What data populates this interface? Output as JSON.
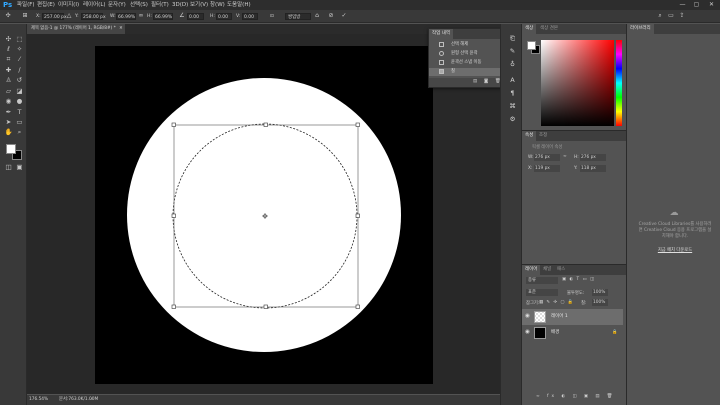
{
  "app": {
    "logo": "Ps"
  },
  "menu": [
    "파일(F)",
    "편집(E)",
    "이미지(I)",
    "레이어(L)",
    "문자(Y)",
    "선택(S)",
    "필터(T)",
    "3D(D)",
    "보기(V)",
    "창(W)",
    "도움말(H)"
  ],
  "window_controls": [
    "—",
    "▢",
    "✕"
  ],
  "options": {
    "x_label": "X:",
    "x_value": "257.00 px",
    "y_label": "Y:",
    "y_value": "258.00 px",
    "w_label": "W:",
    "w_value": "66.99%",
    "h_label": "H:",
    "h_value": "66.99%",
    "angle_value": "0.00",
    "h2_label": "H:",
    "h2_value": "0.00",
    "v_label": "V:",
    "v_value": "0.00",
    "interp_value": "쌍입방"
  },
  "document": {
    "tab_title": "제목 없음-1 @ 177% (레이어 1, RGB/8#) *",
    "tab_close": "✕",
    "background_color": "#000000",
    "circle_color": "#ffffff"
  },
  "status": {
    "zoom": "176.54%",
    "doc_info": "문서:763.0K/1.00M"
  },
  "history": {
    "tab": "작업 내역",
    "items": [
      "선택 해제",
      "원형 선택 윤곽",
      "윤곽선 스냅 이동",
      "칠"
    ],
    "selected_index": 3
  },
  "color_panel": {
    "tabs": [
      "색상",
      "색상 견본"
    ],
    "fg_color": "#ffffff",
    "bg_color": "#000000",
    "hue_color": "#ff0000"
  },
  "properties": {
    "tabs": [
      "속성",
      "조정"
    ],
    "section": "픽셀 레이어 속성",
    "w_label": "W:",
    "w_value": "276 px",
    "h_label": "H:",
    "h_value": "276 px",
    "x_label": "X:",
    "x_value": "119 px",
    "y_label": "Y:",
    "y_value": "118 px"
  },
  "libraries": {
    "tab": "라이브러리",
    "message": "Creative Cloud Libraries를 사용하려면 Creative Cloud 응용 프로그램을 설치해야 합니다.",
    "link": "지금 페치 다운로드"
  },
  "layers": {
    "tabs": [
      "레이어",
      "채널",
      "패스"
    ],
    "filter_label": "종류",
    "blend_mode": "표준",
    "opacity_label": "불투명도:",
    "opacity_value": "100%",
    "lock_label": "잠그기:",
    "fill_label": "칠:",
    "fill_value": "100%",
    "items": [
      {
        "name": "레이어 1",
        "selected": true,
        "thumb": "#ffffff"
      },
      {
        "name": "배경",
        "selected": false,
        "thumb": "#000000",
        "locked": true
      }
    ]
  }
}
